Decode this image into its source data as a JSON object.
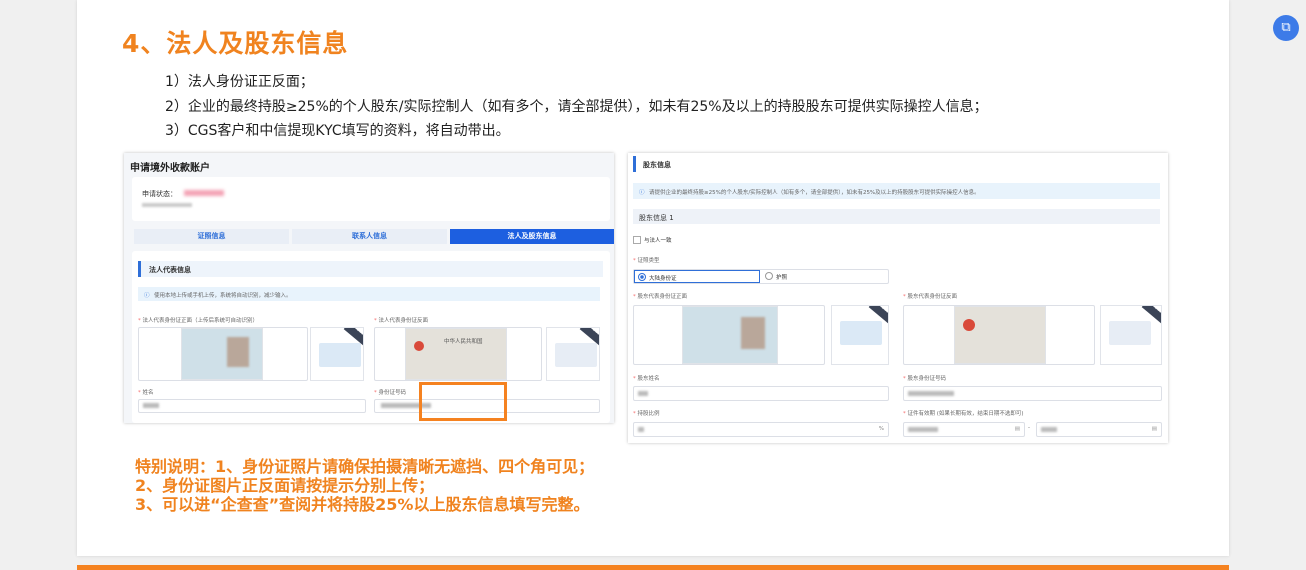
{
  "title": "4、法人及股东信息",
  "list": [
    "1）法人身份证正反面；",
    "2）企业的最终持股≥25%的个人股东/实际控制人（如有多个，请全部提供），如未有25%及以上的持股股东可提供实际操控人信息；",
    "3）CGS客户和中信提现KYC填写的资料，将自动带出。"
  ],
  "side_icon": "screenshot-icon",
  "left_shot": {
    "header": "申请境外收款账户",
    "status_label": "申请状态：",
    "steps": [
      "证照信息",
      "联系人信息",
      "法人及股东信息"
    ],
    "section_title": "法人代表信息",
    "tip": "使用本地上传或手机上传，系统将自动识别，减少输入。",
    "front_label": "法人代表身份证正面（上传后系统可自动识别）",
    "back_label": "法人代表身份证反面",
    "back_card_text": "中华人民共和国",
    "sample_text": "示例",
    "name_label": "姓名",
    "id_label": "身份证号码"
  },
  "right_shot": {
    "header": "股东信息",
    "tip": "请提供企业的最终持股≥25%的个人股东/实际控制人（如有多个，请全部提供），如未有25%及以上的持股股东可提供实际操控人信息。",
    "subsection": "股东信息 1",
    "same_as_legal": "与法人一致",
    "doc_type_label": "证照类型",
    "doc_options": [
      "大陆身份证",
      "护照"
    ],
    "front_label": "股东代表身份证正面",
    "back_label": "股东代表身份证反面",
    "name_label": "股东姓名",
    "id_label": "股东身份证号码",
    "ratio_label": "持股比例",
    "ratio_unit": "%",
    "validity_label": "证件有效期 (如果长期有效，结束日期不选即可)",
    "range_sep": "-"
  },
  "note": [
    "特别说明：1、身份证照片请确保拍摄清晰无遮挡、四个角可见；",
    "2、身份证图片正反面请按提示分别上传；",
    "3、可以进“企查查”查阅并将持股25%以上股东信息填写完整。"
  ],
  "colors": {
    "accent": "#f0831f",
    "primary": "#2f6fd8"
  }
}
